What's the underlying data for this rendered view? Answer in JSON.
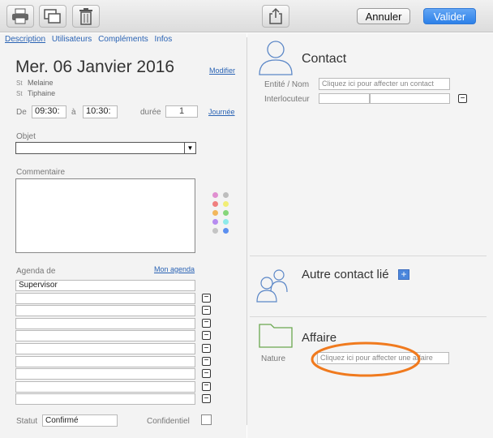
{
  "toolbar": {
    "print_icon": "printer-icon",
    "duplicate_icon": "duplicate-icon",
    "delete_icon": "trash-icon",
    "share_icon": "share-icon",
    "cancel_label": "Annuler",
    "validate_label": "Valider"
  },
  "tabs": [
    "Description",
    "Utilisateurs",
    "Compléments",
    "Infos"
  ],
  "event": {
    "date": "Mer. 06 Janvier 2016",
    "modify_link": "Modifier",
    "participants": [
      {
        "prefix": "St",
        "name": "Melaine"
      },
      {
        "prefix": "St",
        "name": "Tiphaine"
      }
    ],
    "from_label": "De",
    "start_time": "09:30:",
    "to_label": "à",
    "end_time": "10:30:",
    "duration_label": "durée",
    "duration_value": "1",
    "day_link": "Journée",
    "object_label": "Objet",
    "object_value": "",
    "comment_label": "Commentaire",
    "comment_value": "",
    "agenda_label": "Agenda de",
    "my_agenda_link": "Mon agenda",
    "agenda_rows": [
      "Supervisor",
      "",
      "",
      "",
      "",
      "",
      "",
      "",
      "",
      ""
    ],
    "status_label": "Statut",
    "status_value": "Confirmé",
    "confidential_label": "Confidentiel"
  },
  "colors": {
    "palette": [
      "#e08fd0",
      "#bdbdbd",
      "#f07f7f",
      "#f2ee75",
      "#f2b75c",
      "#86d67a",
      "#b68bf0",
      "#8eeaea",
      "#c4c4c4",
      "#5b8ff0"
    ],
    "accent": "#2c80e8",
    "highlight_ellipse": "#f07a1e"
  },
  "contact": {
    "title": "Contact",
    "entity_label": "Entité / Nom",
    "entity_placeholder": "Cliquez ici pour affecter un contact",
    "interlocutor_label": "Interlocuteur",
    "interlocutor_value": ""
  },
  "other_contact": {
    "title": "Autre contact lié",
    "add_icon": "plus-icon"
  },
  "affaire": {
    "title": "Affaire",
    "nature_label": "Nature",
    "nature_placeholder": "Cliquez ici pour affecter une affaire"
  }
}
